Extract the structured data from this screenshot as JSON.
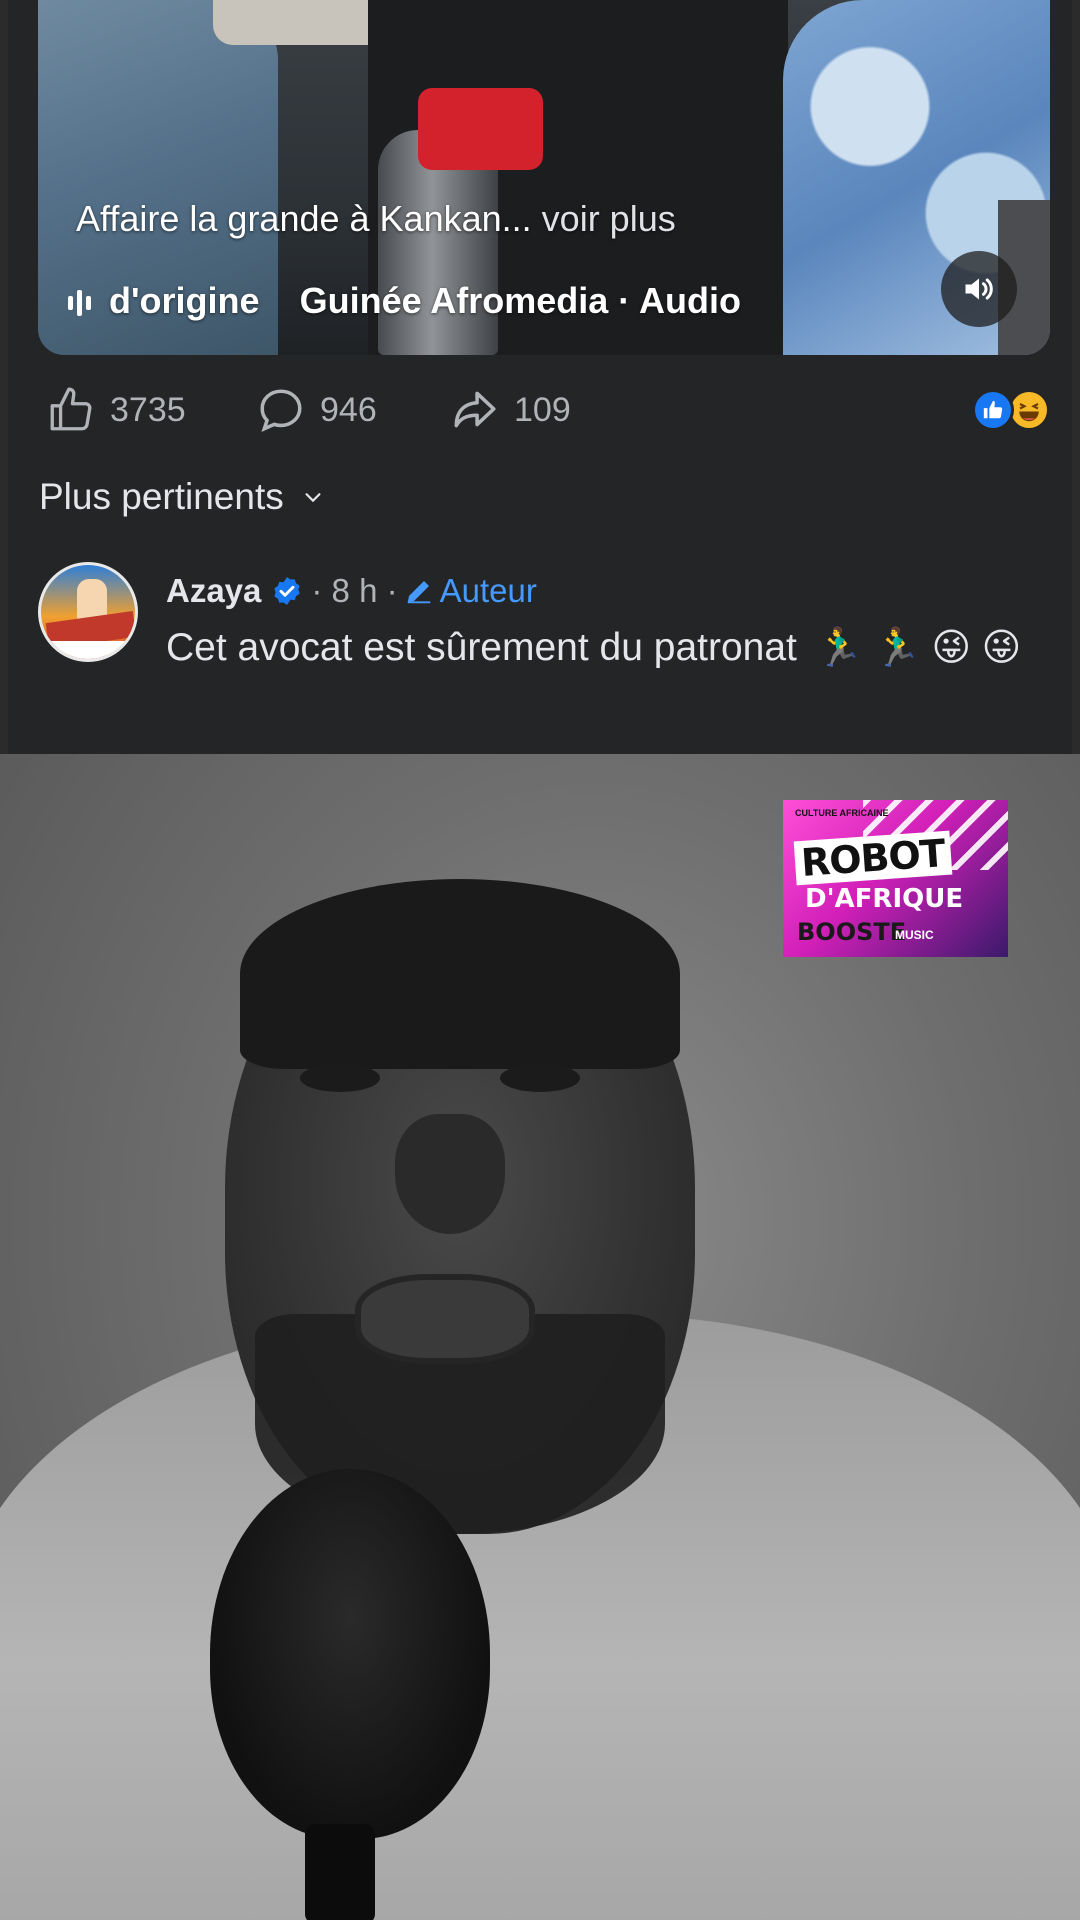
{
  "post": {
    "caption": "Affaire la grande à Kankan...",
    "see_more": "voir plus",
    "audio_prefix": "d'origine",
    "audio_source": "Guinée Afromedia · Audio",
    "stats": {
      "likes": "3735",
      "comments": "946",
      "shares": "109"
    },
    "icons": [
      "like-icon",
      "comment-icon",
      "share-icon",
      "sound-on-icon",
      "audio-wave-icon"
    ]
  },
  "comments": {
    "sort_label": "Plus pertinents",
    "items": [
      {
        "author": "Azaya",
        "time": "· 8 h ·",
        "badge": "Auteur",
        "text": "Cet avocat est sûrement du patronat",
        "emojis": "🏃‍♂️ 🏃‍♂️ 😜 😜"
      }
    ]
  },
  "video": {
    "logo": {
      "small": "CULTURE AFRICAINE",
      "title": "ROBOT",
      "subtitle": "D'AFRIQUE",
      "booste": "BOOSTE",
      "music": "MUSIC"
    }
  },
  "colors": {
    "card_bg": "#242526",
    "text_primary": "#e4e6eb",
    "text_secondary": "#b0b3b8",
    "link_blue": "#4599ff",
    "like_blue": "#1877f2"
  }
}
